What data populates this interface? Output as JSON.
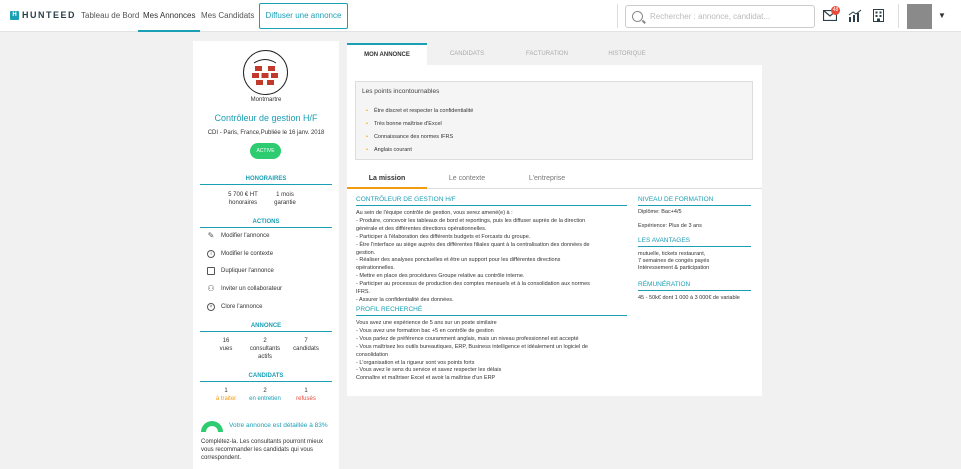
{
  "brand": {
    "logo_text": "HUNTEED",
    "logo_mark": "H"
  },
  "nav": {
    "items": [
      "Tableau de Bord",
      "Mes Annonces",
      "Mes Candidats"
    ],
    "cta": "Diffuser une annonce"
  },
  "search": {
    "placeholder": "Rechercher : annonce, candidat..."
  },
  "topicons": {
    "mail_badge": "48"
  },
  "colors": {
    "accent": "#1a9fb5",
    "active_pill": "#2ecc71",
    "warning": "#f39c12",
    "danger": "#e74c3c"
  },
  "job": {
    "company": "Montmartre",
    "title": "Contrôleur de gestion H/F",
    "subtitle": "CDI - Paris, France,Publiée le 16 janv. 2018",
    "status": "ACTIVE"
  },
  "honoraires": {
    "heading": "HONORAIRES",
    "amount": "5 700 € HT",
    "amount_label": "honoraires",
    "guarantee": "1 mois",
    "guarantee_label": "garantie"
  },
  "actions": {
    "heading": "ACTIONS",
    "items": [
      "Modifier l'annonce",
      "Modifier le contexte",
      "Dupliquer l'annonce",
      "Inviter un collaborateur",
      "Clore l'annonce"
    ]
  },
  "annonce": {
    "heading": "ANNONCE",
    "stats": [
      {
        "value": "16",
        "label": "vues"
      },
      {
        "value": "2",
        "label": "consultants actifs"
      },
      {
        "value": "7",
        "label": "candidats"
      }
    ]
  },
  "candidats": {
    "heading": "CANDIDATS",
    "stats": [
      {
        "value": "1",
        "label": "à traiter"
      },
      {
        "value": "2",
        "label": "en entretien"
      },
      {
        "value": "1",
        "label": "refusés"
      }
    ]
  },
  "completion": {
    "percent": 83,
    "text": "Votre annonce est détaillée à 83%",
    "help": "Complétez-la. Les consultants pourront mieux vous recommander les candidats qui vous correspondent."
  },
  "tabs": [
    "MON ANNONCE",
    "CANDIDATS",
    "FACTURATION",
    "HISTORIQUE"
  ],
  "highlights": {
    "title": "Les points incontournables",
    "items": [
      "Être discret et respecter la confidentialité",
      "Très bonne maîtrise d'Excel",
      "Connaissance des normes IFRS",
      "Anglais courant"
    ]
  },
  "subtabs": [
    "La mission",
    "Le contexte",
    "L'entreprise"
  ],
  "mission": {
    "heading": "CONTRÔLEUR DE GESTION H/F",
    "lines": [
      "Au sein de l'équipe contrôle de gestion, vous serez amené(e) à :",
      "-      Produire, concevoir les tableaux de bord et reportings, puis les diffuser auprès de la direction",
      "générale et des différentes directions opérationnelles.",
      "-      Participer à l'élaboration des différents budgets et Forcasts du groupe.",
      "-      Être l'interface au siège auprès des différentes filiales quant à la centralisation des données de",
      "gestion.",
      "-      Réaliser des analyses ponctuelles et être un support pour les différentes directions",
      "opérationnelles.",
      "-      Mettre en place des procédures Groupe relative au contrôle interne.",
      "-      Participer au processus de production des comptes mensuels et à la consolidation aux normes",
      "IFRS.",
      "-      Assurer la confidentialité des données."
    ],
    "profile_heading": "PROFIL RECHERCHÉ",
    "profile_lines": [
      "Vous avez une expérience de 5 ans sur un poste similaire",
      "-      Vous avez une formation bac +5 en contrôle de gestion",
      "-      Vous parlez de préférence couramment anglais, mais un niveau professionnel est accepté",
      "-      Vous maîtrisez les outils bureautiques, ERP, Business intelligence et idéalement un logiciel de",
      "consolidation",
      "-      L'organisation et la rigueur sont vos points forts",
      "-      Vous avez le sens du service et savez respecter les délais",
      "Connaître et maîtriser Excel et avoir la maîtrise d'un ERP"
    ]
  },
  "side": {
    "formation_heading": "NIVEAU DE FORMATION",
    "diploma": "Diplôme: Bac+4/5",
    "experience": "Expérience: Plus de 3 ans",
    "avantages_heading": "LES AVANTAGES",
    "avantages": [
      "mutuelle, tickets restaurant,",
      "7 semaines de congés payés",
      "Intéressement & participation"
    ],
    "remuneration_heading": "RÉMUNÉRATION",
    "remuneration": "45 - 50k€ dont 1 000 à 3 000€ de variable"
  }
}
